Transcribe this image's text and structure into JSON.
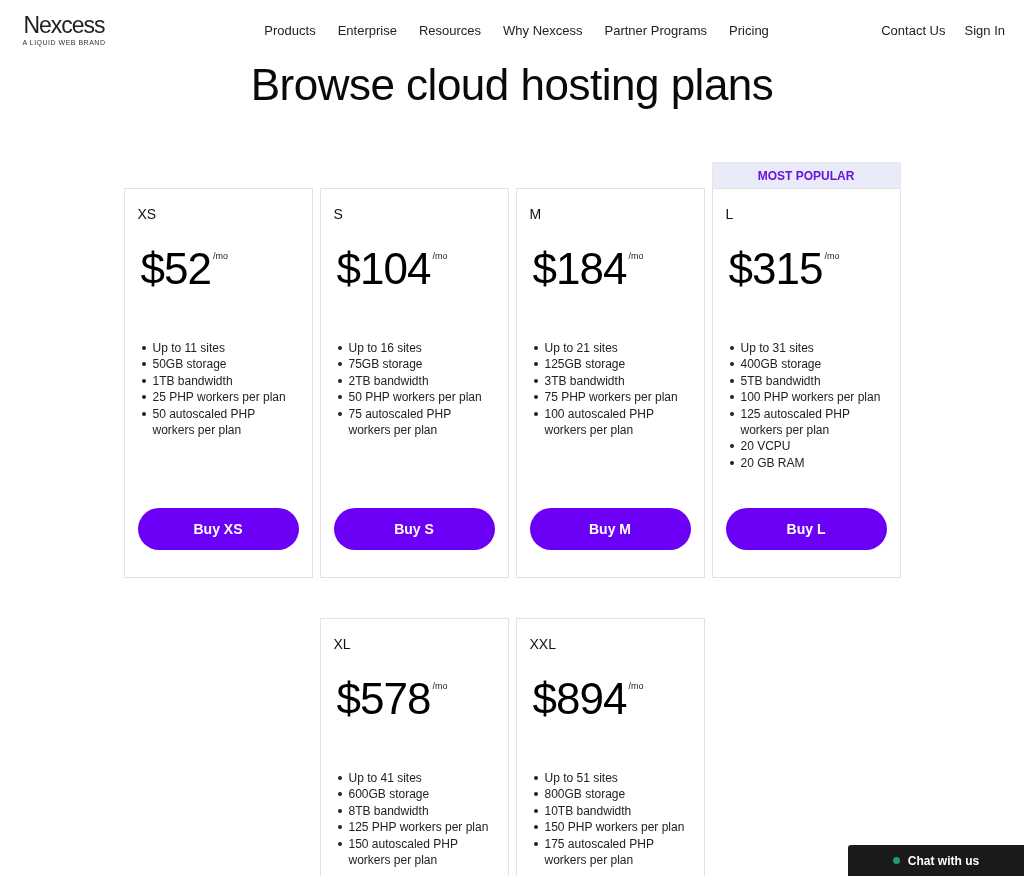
{
  "header": {
    "logo": "Nexcess",
    "tagline": "A LIQUID WEB BRAND",
    "nav": [
      "Products",
      "Enterprise",
      "Resources",
      "Why Nexcess",
      "Partner Programs",
      "Pricing"
    ],
    "actions": [
      "Contact Us",
      "Sign In"
    ]
  },
  "title": "Browse cloud hosting plans",
  "plans": [
    {
      "name": "XS",
      "price": "$52",
      "period": "/mo",
      "features": [
        "Up to 11 sites",
        "50GB storage",
        "1TB bandwidth",
        "25 PHP workers per plan",
        "50 autoscaled PHP workers per plan"
      ],
      "button": "Buy XS"
    },
    {
      "name": "S",
      "price": "$104",
      "period": "/mo",
      "features": [
        "Up to 16 sites",
        "75GB storage",
        "2TB bandwidth",
        "50 PHP workers per plan",
        "75 autoscaled PHP workers per plan"
      ],
      "button": "Buy S"
    },
    {
      "name": "M",
      "price": "$184",
      "period": "/mo",
      "features": [
        "Up to 21 sites",
        "125GB storage",
        "3TB bandwidth",
        "75 PHP workers per plan",
        "100 autoscaled PHP workers per plan"
      ],
      "button": "Buy M"
    },
    {
      "name": "L",
      "badge": "MOST POPULAR",
      "price": "$315",
      "period": "/mo",
      "features": [
        "Up to 31 sites",
        "400GB storage",
        "5TB bandwidth",
        "100 PHP workers per plan",
        "125 autoscaled PHP workers per plan",
        "20 VCPU",
        "20 GB RAM"
      ],
      "button": "Buy L"
    },
    {
      "name": "XL",
      "price": "$578",
      "period": "/mo",
      "features": [
        "Up to 41 sites",
        "600GB storage",
        "8TB bandwidth",
        "125 PHP workers per plan",
        "150 autoscaled PHP workers per plan"
      ]
    },
    {
      "name": "XXL",
      "price": "$894",
      "period": "/mo",
      "features": [
        "Up to 51 sites",
        "800GB storage",
        "10TB bandwidth",
        "150 PHP workers per plan",
        "175 autoscaled PHP workers per plan"
      ]
    }
  ],
  "chat": {
    "label": "Chat with us"
  }
}
